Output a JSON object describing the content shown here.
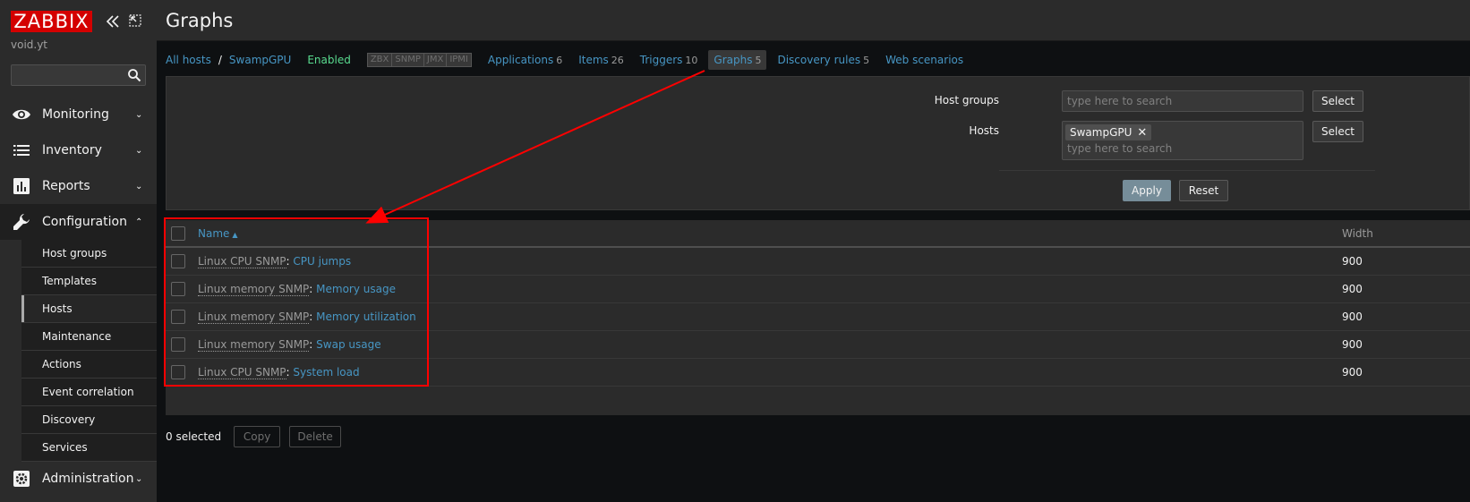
{
  "sidebar": {
    "logo": "ZABBIX",
    "server_name": "void.yt",
    "search_value": "",
    "menu": [
      {
        "label": "Monitoring",
        "icon": "eye-icon"
      },
      {
        "label": "Inventory",
        "icon": "list-icon"
      },
      {
        "label": "Reports",
        "icon": "bar-chart-icon"
      },
      {
        "label": "Configuration",
        "icon": "wrench-icon"
      },
      {
        "label": "Administration",
        "icon": "gear-icon"
      }
    ],
    "submenu": [
      "Host groups",
      "Templates",
      "Hosts",
      "Maintenance",
      "Actions",
      "Event correlation",
      "Discovery",
      "Services"
    ],
    "submenu_selected": "Hosts"
  },
  "header": {
    "title": "Graphs"
  },
  "nav": {
    "all_hosts": "All hosts",
    "separator": "/",
    "host": "SwampGPU",
    "status": "Enabled",
    "availability": [
      "ZBX",
      "SNMP",
      "JMX",
      "IPMI"
    ],
    "tabs": [
      {
        "label": "Applications",
        "count": "6"
      },
      {
        "label": "Items",
        "count": "26"
      },
      {
        "label": "Triggers",
        "count": "10"
      },
      {
        "label": "Graphs",
        "count": "5"
      },
      {
        "label": "Discovery rules",
        "count": "5"
      },
      {
        "label": "Web scenarios",
        "count": ""
      }
    ]
  },
  "filter": {
    "host_groups_label": "Host groups",
    "host_groups_placeholder": "type here to search",
    "hosts_label": "Hosts",
    "hosts_chip": "SwampGPU",
    "hosts_placeholder": "type here to search",
    "select_label": "Select",
    "apply_label": "Apply",
    "reset_label": "Reset"
  },
  "table": {
    "col_name": "Name",
    "col_width": "Width",
    "rows": [
      {
        "template": "Linux CPU SNMP",
        "name": "CPU jumps",
        "width": "900"
      },
      {
        "template": "Linux memory SNMP",
        "name": "Memory usage",
        "width": "900"
      },
      {
        "template": "Linux memory SNMP",
        "name": "Memory utilization",
        "width": "900"
      },
      {
        "template": "Linux memory SNMP",
        "name": "Swap usage",
        "width": "900"
      },
      {
        "template": "Linux CPU SNMP",
        "name": "System load",
        "width": "900"
      }
    ]
  },
  "footer": {
    "selected": "0 selected",
    "copy_label": "Copy",
    "delete_label": "Delete"
  },
  "colors": {
    "accent_link": "#4796c4",
    "enabled": "#59db8f",
    "annotation": "#ff0000",
    "logo_bg": "#d40000"
  }
}
